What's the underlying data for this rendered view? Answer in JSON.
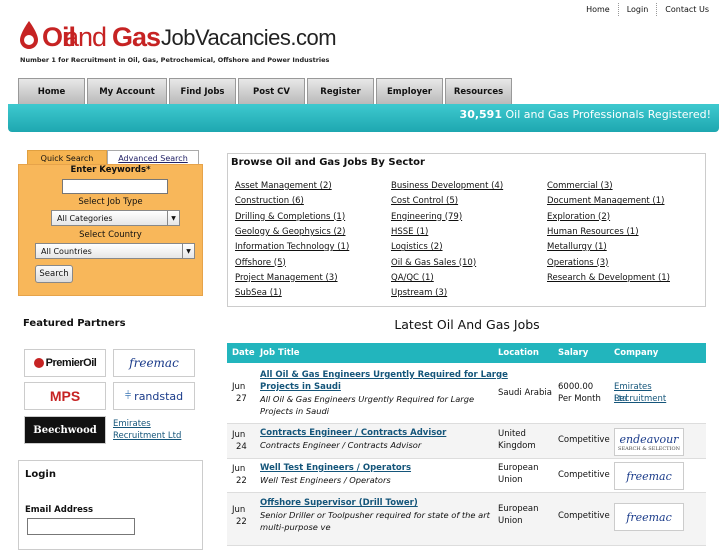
{
  "top_links": [
    "Home",
    "Login",
    "Contact Us"
  ],
  "logo": {
    "oil": "Oil",
    "and": "and",
    "gas": "Gas",
    "rest": "JobVacancies.com",
    "tagline": "Number 1 for Recruitment in Oil, Gas, Petrochemical, Offshore and Power Industries"
  },
  "nav": [
    "Home",
    "My Account",
    "Find Jobs",
    "Post CV",
    "Register",
    "Employer",
    "Resources"
  ],
  "banner": {
    "count": "30,591",
    "text": " Oil and Gas Professionals Registered!"
  },
  "search": {
    "tab_quick": "Quick Search",
    "tab_advanced": "Advanced Search",
    "keywords_label": "Enter Keywords*",
    "keywords_value": "",
    "job_type_label": "Select Job Type",
    "job_type_value": "All Categories",
    "country_label": "Select Country",
    "country_value": "All Countries",
    "button": "Search"
  },
  "featured": {
    "title": "Featured Partners",
    "partners": [
      "PremierOil",
      "freemac",
      "MPS",
      "randstad",
      "Beechwood",
      "Emirates Recruitment Ltd"
    ]
  },
  "login": {
    "title": "Login",
    "email_label": "Email Address",
    "email_value": ""
  },
  "sectors": {
    "title": "Browse Oil and Gas Jobs By Sector",
    "col1": [
      "Asset Management (2)",
      "Construction (6)",
      "Drilling & Completions (1)",
      "Geology & Geophysics (2)",
      "Information Technology (1)",
      "Offshore (5)",
      "Project Management (3)",
      "SubSea (1)"
    ],
    "col2": [
      "Business Development (4)",
      "Cost Control (5)",
      "Engineering (79)",
      "HSSE (1)",
      "Logistics (2)",
      "Oil & Gas Sales (10)",
      "QA/QC (1)",
      "Upstream (3)"
    ],
    "col3": [
      "Commercial (3)",
      "Document Management (1)",
      "Exploration (2)",
      "Human Resources (1)",
      "Metallurgy (1)",
      "Operations (3)",
      "Research & Development (1)"
    ]
  },
  "latest": {
    "title": "Latest Oil And Gas Jobs",
    "headers": [
      "Date",
      "Job Title",
      "Location",
      "Salary",
      "Company"
    ],
    "jobs": [
      {
        "month": "Jun",
        "day": "27",
        "title_l1": "All Oil & Gas Engineers Urgently Required for Large",
        "title_l2": "Projects in Saudi",
        "desc_l1": "All Oil & Gas Engineers Urgently Required for Large",
        "desc_l2": "Projects in Saudi",
        "loc_l1": "Saudi Arabia",
        "loc_l2": "",
        "sal_l1": "6000.00",
        "sal_l2": "Per Month",
        "company_l1": "Emirates Recruitment",
        "company_l2": "Ltd"
      },
      {
        "month": "Jun",
        "day": "24",
        "title_l1": "Contracts Engineer / Contracts Advisor",
        "title_l2": "",
        "desc_l1": "Contracts Engineer / Contracts Advisor",
        "desc_l2": "",
        "loc_l1": "United",
        "loc_l2": "Kingdom",
        "sal_l1": "Competitive",
        "sal_l2": "",
        "company_logo": "endeavour",
        "company_logo_sub": "SEARCH & SELECTION"
      },
      {
        "month": "Jun",
        "day": "22",
        "title_l1": "Well Test Engineers / Operators",
        "title_l2": "",
        "desc_l1": "Well Test Engineers / Operators",
        "desc_l2": "",
        "loc_l1": "European",
        "loc_l2": "Union",
        "sal_l1": "Competitive",
        "sal_l2": "",
        "company_logo": "freemac"
      },
      {
        "month": "Jun",
        "day": "22",
        "title_l1": "Offshore Supervisor (Drill Tower)",
        "title_l2": "",
        "desc_l1": "Senior Driller or Toolpusher required for state of the art",
        "desc_l2": "multi-purpose ve",
        "loc_l1": "European",
        "loc_l2": "Union",
        "sal_l1": "Competitive",
        "sal_l2": "",
        "company_logo": "freemac"
      }
    ]
  },
  "colors": {
    "accent": "#22b5bd",
    "search_bg": "#f8b75a",
    "logo_red": "#c62323",
    "link": "#14557a"
  }
}
